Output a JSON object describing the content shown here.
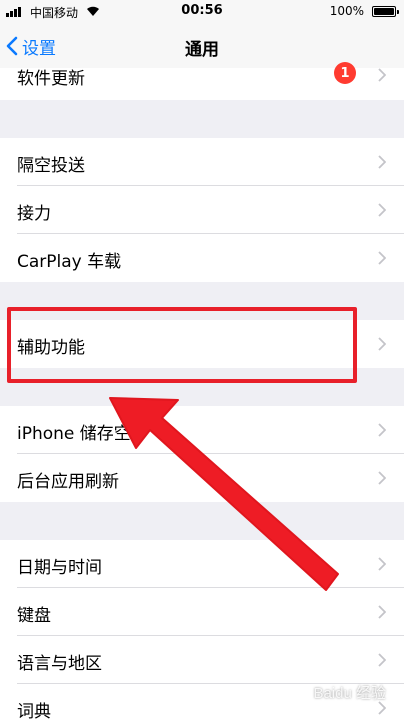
{
  "status_bar": {
    "carrier": "中国移动",
    "time": "00:56",
    "battery": "100%"
  },
  "nav": {
    "back_label": "设置",
    "title": "通用"
  },
  "rows": {
    "software_update": {
      "label": "软件更新",
      "badge": "1"
    },
    "airdrop": {
      "label": "隔空投送"
    },
    "handoff": {
      "label": "接力"
    },
    "carplay": {
      "label": "CarPlay 车载"
    },
    "accessibility": {
      "label": "辅助功能"
    },
    "iphone_storage": {
      "label": "iPhone 储存空"
    },
    "background_refresh": {
      "label": "后台应用刷新"
    },
    "date_time": {
      "label": "日期与时间"
    },
    "keyboard": {
      "label": "键盘"
    },
    "language_region": {
      "label": "语言与地区"
    },
    "dictionary": {
      "label": "词典"
    }
  },
  "watermark": "Baidu 经验",
  "colors": {
    "accent": "#0a7aff",
    "highlight": "#e8202a",
    "badge": "#ff3b30",
    "background": "#efeff4"
  },
  "icons": {
    "back": "chevron-left-icon",
    "row_disclosure": "chevron-right-icon",
    "annotation": "arrow-icon"
  }
}
